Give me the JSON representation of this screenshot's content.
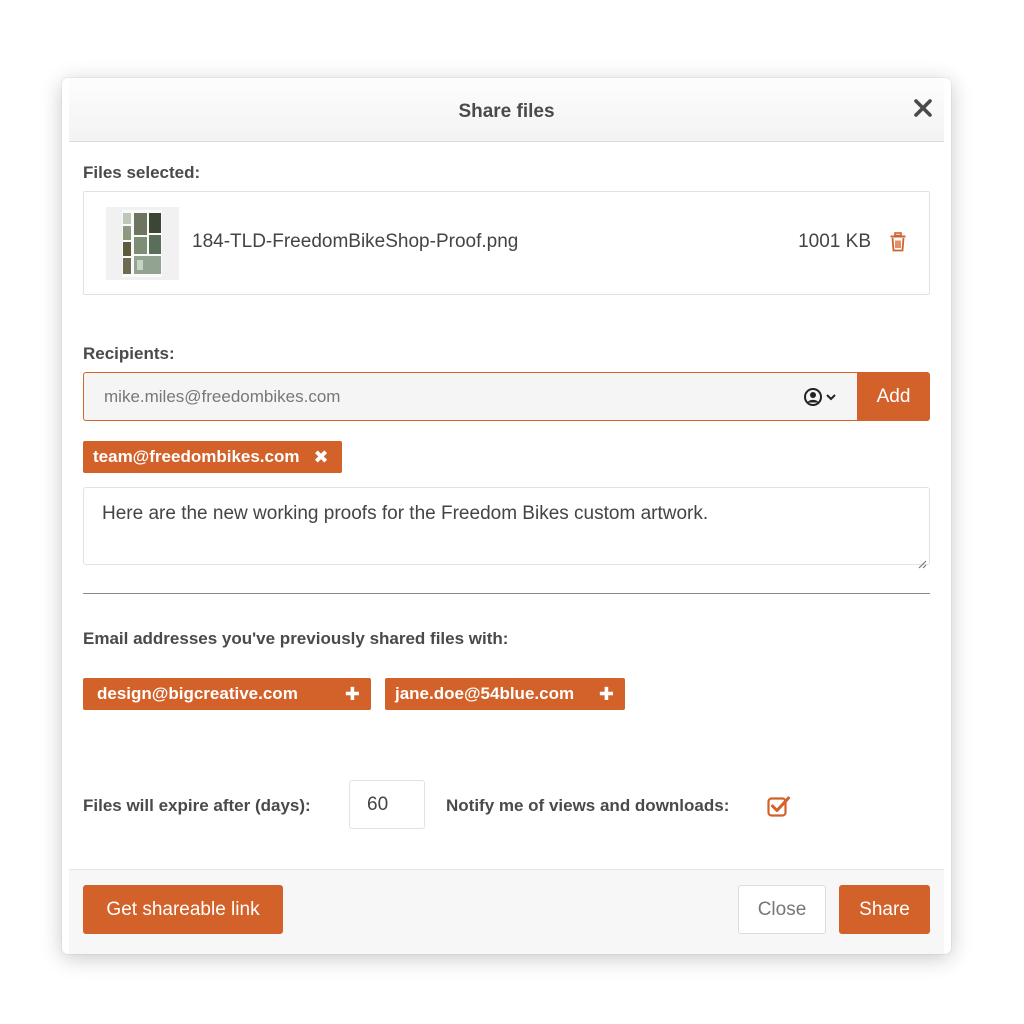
{
  "dialog": {
    "title": "Share files"
  },
  "files_section": {
    "label": "Files selected:",
    "files": [
      {
        "name": "184-TLD-FreedomBikeShop-Proof.png",
        "size": "1001 KB"
      }
    ]
  },
  "recipients_section": {
    "label": "Recipients:",
    "input_placeholder": "mike.miles@freedombikes.com",
    "input_value": "",
    "add_label": "Add",
    "tags": [
      {
        "email": "team@freedombikes.com"
      }
    ]
  },
  "message": {
    "text": "Here are the new working proofs for the Freedom Bikes custom artwork."
  },
  "previous_section": {
    "label": "Email addresses you've previously shared files with:",
    "addresses": [
      {
        "email": "design@bigcreative.com"
      },
      {
        "email": "jane.doe@54blue.com"
      }
    ]
  },
  "options": {
    "expire_label": "Files will expire after (days):",
    "expire_value": "60",
    "notify_label": "Notify me of views and downloads:",
    "notify_checked": true
  },
  "footer": {
    "link_label": "Get shareable link",
    "close_label": "Close",
    "share_label": "Share"
  },
  "colors": {
    "accent": "#d2612a",
    "text": "#444444"
  },
  "icons": {
    "close": "close-icon",
    "trash": "trash-icon",
    "contacts": "user-circle-icon",
    "remove_tag": "close-icon",
    "add_tag": "plus-icon",
    "checkbox": "checkbox-checked-icon"
  }
}
